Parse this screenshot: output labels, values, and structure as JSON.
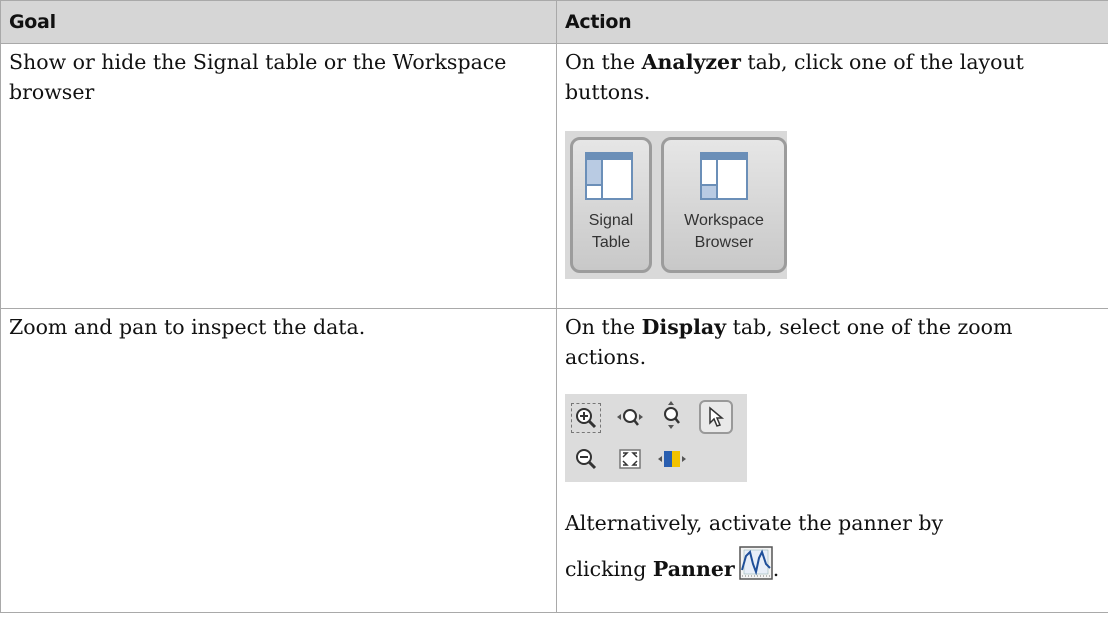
{
  "table": {
    "headers": {
      "goal": "Goal",
      "action": "Action"
    },
    "rows": [
      {
        "goal": "Show or hide the Signal table or the Workspace browser",
        "action_prefix": "On the ",
        "action_bold": "Analyzer",
        "action_suffix": " tab, click one of the layout buttons."
      },
      {
        "goal": "Zoom and pan to inspect the data.",
        "action_prefix": "On the ",
        "action_bold": "Display",
        "action_suffix": " tab, select one of the zoom actions.",
        "alt_text": "Alternatively, activate the panner by",
        "alt_prefix": "clicking ",
        "alt_bold": "Panner",
        "alt_suffix": "."
      }
    ]
  },
  "layout_buttons": [
    {
      "line1": "Signal",
      "line2": "Table",
      "icon": "signal-table-layout-icon"
    },
    {
      "line1": "Workspace",
      "line2": "Browser",
      "icon": "workspace-browser-layout-icon"
    }
  ],
  "zoom_icons": [
    "zoom-in-icon",
    "zoom-x-icon",
    "zoom-y-icon",
    "cursor-icon",
    "zoom-out-icon",
    "fit-to-view-icon",
    "panner-slider-icon"
  ],
  "colors": {
    "header_bg": "#d6d6d6",
    "border": "#a9a9a9",
    "toolbar_bg": "#dcdcdc",
    "icon_blue": "#6b8fb8"
  }
}
